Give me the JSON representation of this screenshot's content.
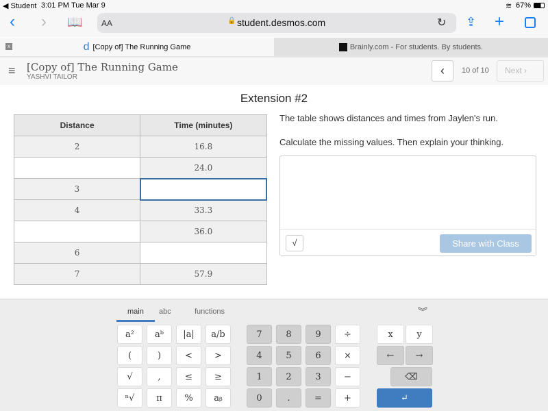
{
  "status": {
    "back_app": "◀ Student",
    "time": "3:01 PM",
    "date": "Tue Mar 9",
    "battery": "67%"
  },
  "browser": {
    "text_size": "AA",
    "url": "student.desmos.com",
    "icons": [
      "back-icon",
      "forward-icon",
      "bookmarks-icon",
      "lock-icon",
      "reload-icon",
      "share-icon",
      "new-tab-icon",
      "tabs-icon"
    ]
  },
  "tabs": [
    {
      "label": "[Copy of] The Running Game",
      "close": "x"
    },
    {
      "label": "Brainly.com - For students. By students."
    }
  ],
  "header": {
    "title": "[Copy of] The Running Game",
    "student": "YASHVI TAILOR",
    "page": "10 of 10",
    "next": "Next"
  },
  "activity": {
    "title": "Extension #2",
    "table": {
      "headers": [
        "Distance",
        "Time (minutes)"
      ],
      "rows": [
        [
          "2",
          "16.8"
        ],
        [
          "",
          "24.0"
        ],
        [
          "3",
          ""
        ],
        [
          "4",
          "33.3"
        ],
        [
          "",
          "36.0"
        ],
        [
          "6",
          ""
        ],
        [
          "7",
          "57.9"
        ]
      ]
    },
    "prompt1": "The table shows distances and times from Jaylen's run.",
    "prompt2": "Calculate the missing values. Then explain your thinking.",
    "share": "Share with Class",
    "math_icon": "√"
  },
  "keyboard": {
    "tabs": [
      "main",
      "abc",
      "functions"
    ],
    "active_tab": "main",
    "left": [
      "a²",
      "aᵇ",
      "|a|",
      "a/b",
      "(",
      ")",
      "<",
      ">",
      "√",
      ",",
      "≤",
      "≥",
      "ⁿ√",
      "π",
      "%",
      "aᵦ"
    ],
    "nums": [
      "7",
      "8",
      "9",
      "÷",
      "4",
      "5",
      "6",
      "×",
      "1",
      "2",
      "3",
      "−",
      "0",
      ".",
      "=",
      "+"
    ],
    "right": [
      "x",
      "y",
      "←",
      "→"
    ],
    "backspace": "⌫",
    "enter": "↵",
    "collapse": "︾"
  },
  "colors": {
    "accent": "#3f7dc0",
    "link": "#1a7ef5",
    "share_disabled": "#a9c6e2"
  }
}
